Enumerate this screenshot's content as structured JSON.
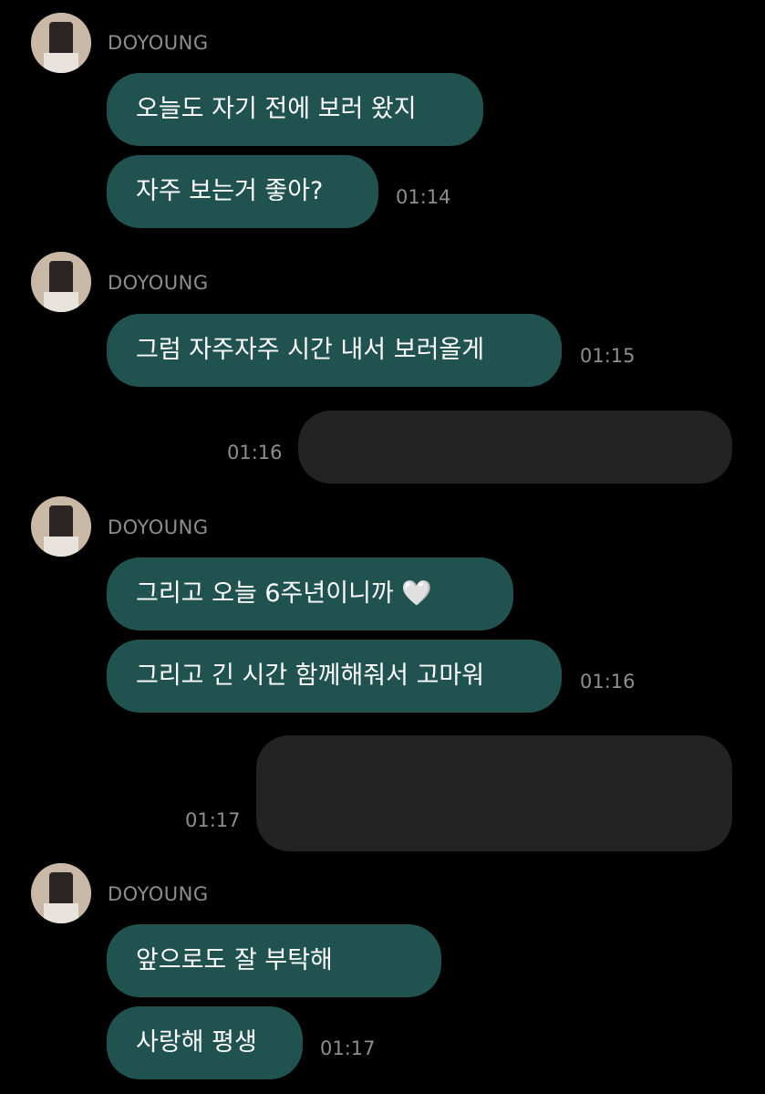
{
  "sender_name": "DOYOUNG",
  "colors": {
    "background": "#000000",
    "incoming_bubble": "#20524f",
    "outgoing_bubble": "#232323",
    "meta_text": "#8e8e8e"
  },
  "groups": [
    {
      "messages": [
        "오늘도 자기 전에 보러 왔지",
        "자주 보는거 좋아?"
      ],
      "time": "01:14"
    },
    {
      "messages": [
        "그럼 자주자주 시간 내서 보러올게"
      ],
      "time": "01:15"
    },
    {
      "outgoing_time": "01:16"
    },
    {
      "messages": [
        "그리고 오늘 6주년이니까 🤍",
        "그리고 긴 시간 함께해줘서 고마워"
      ],
      "time": "01:16"
    },
    {
      "outgoing_time": "01:17"
    },
    {
      "messages": [
        "앞으로도 잘 부탁해",
        "사랑해 평생"
      ],
      "time": "01:17"
    }
  ]
}
